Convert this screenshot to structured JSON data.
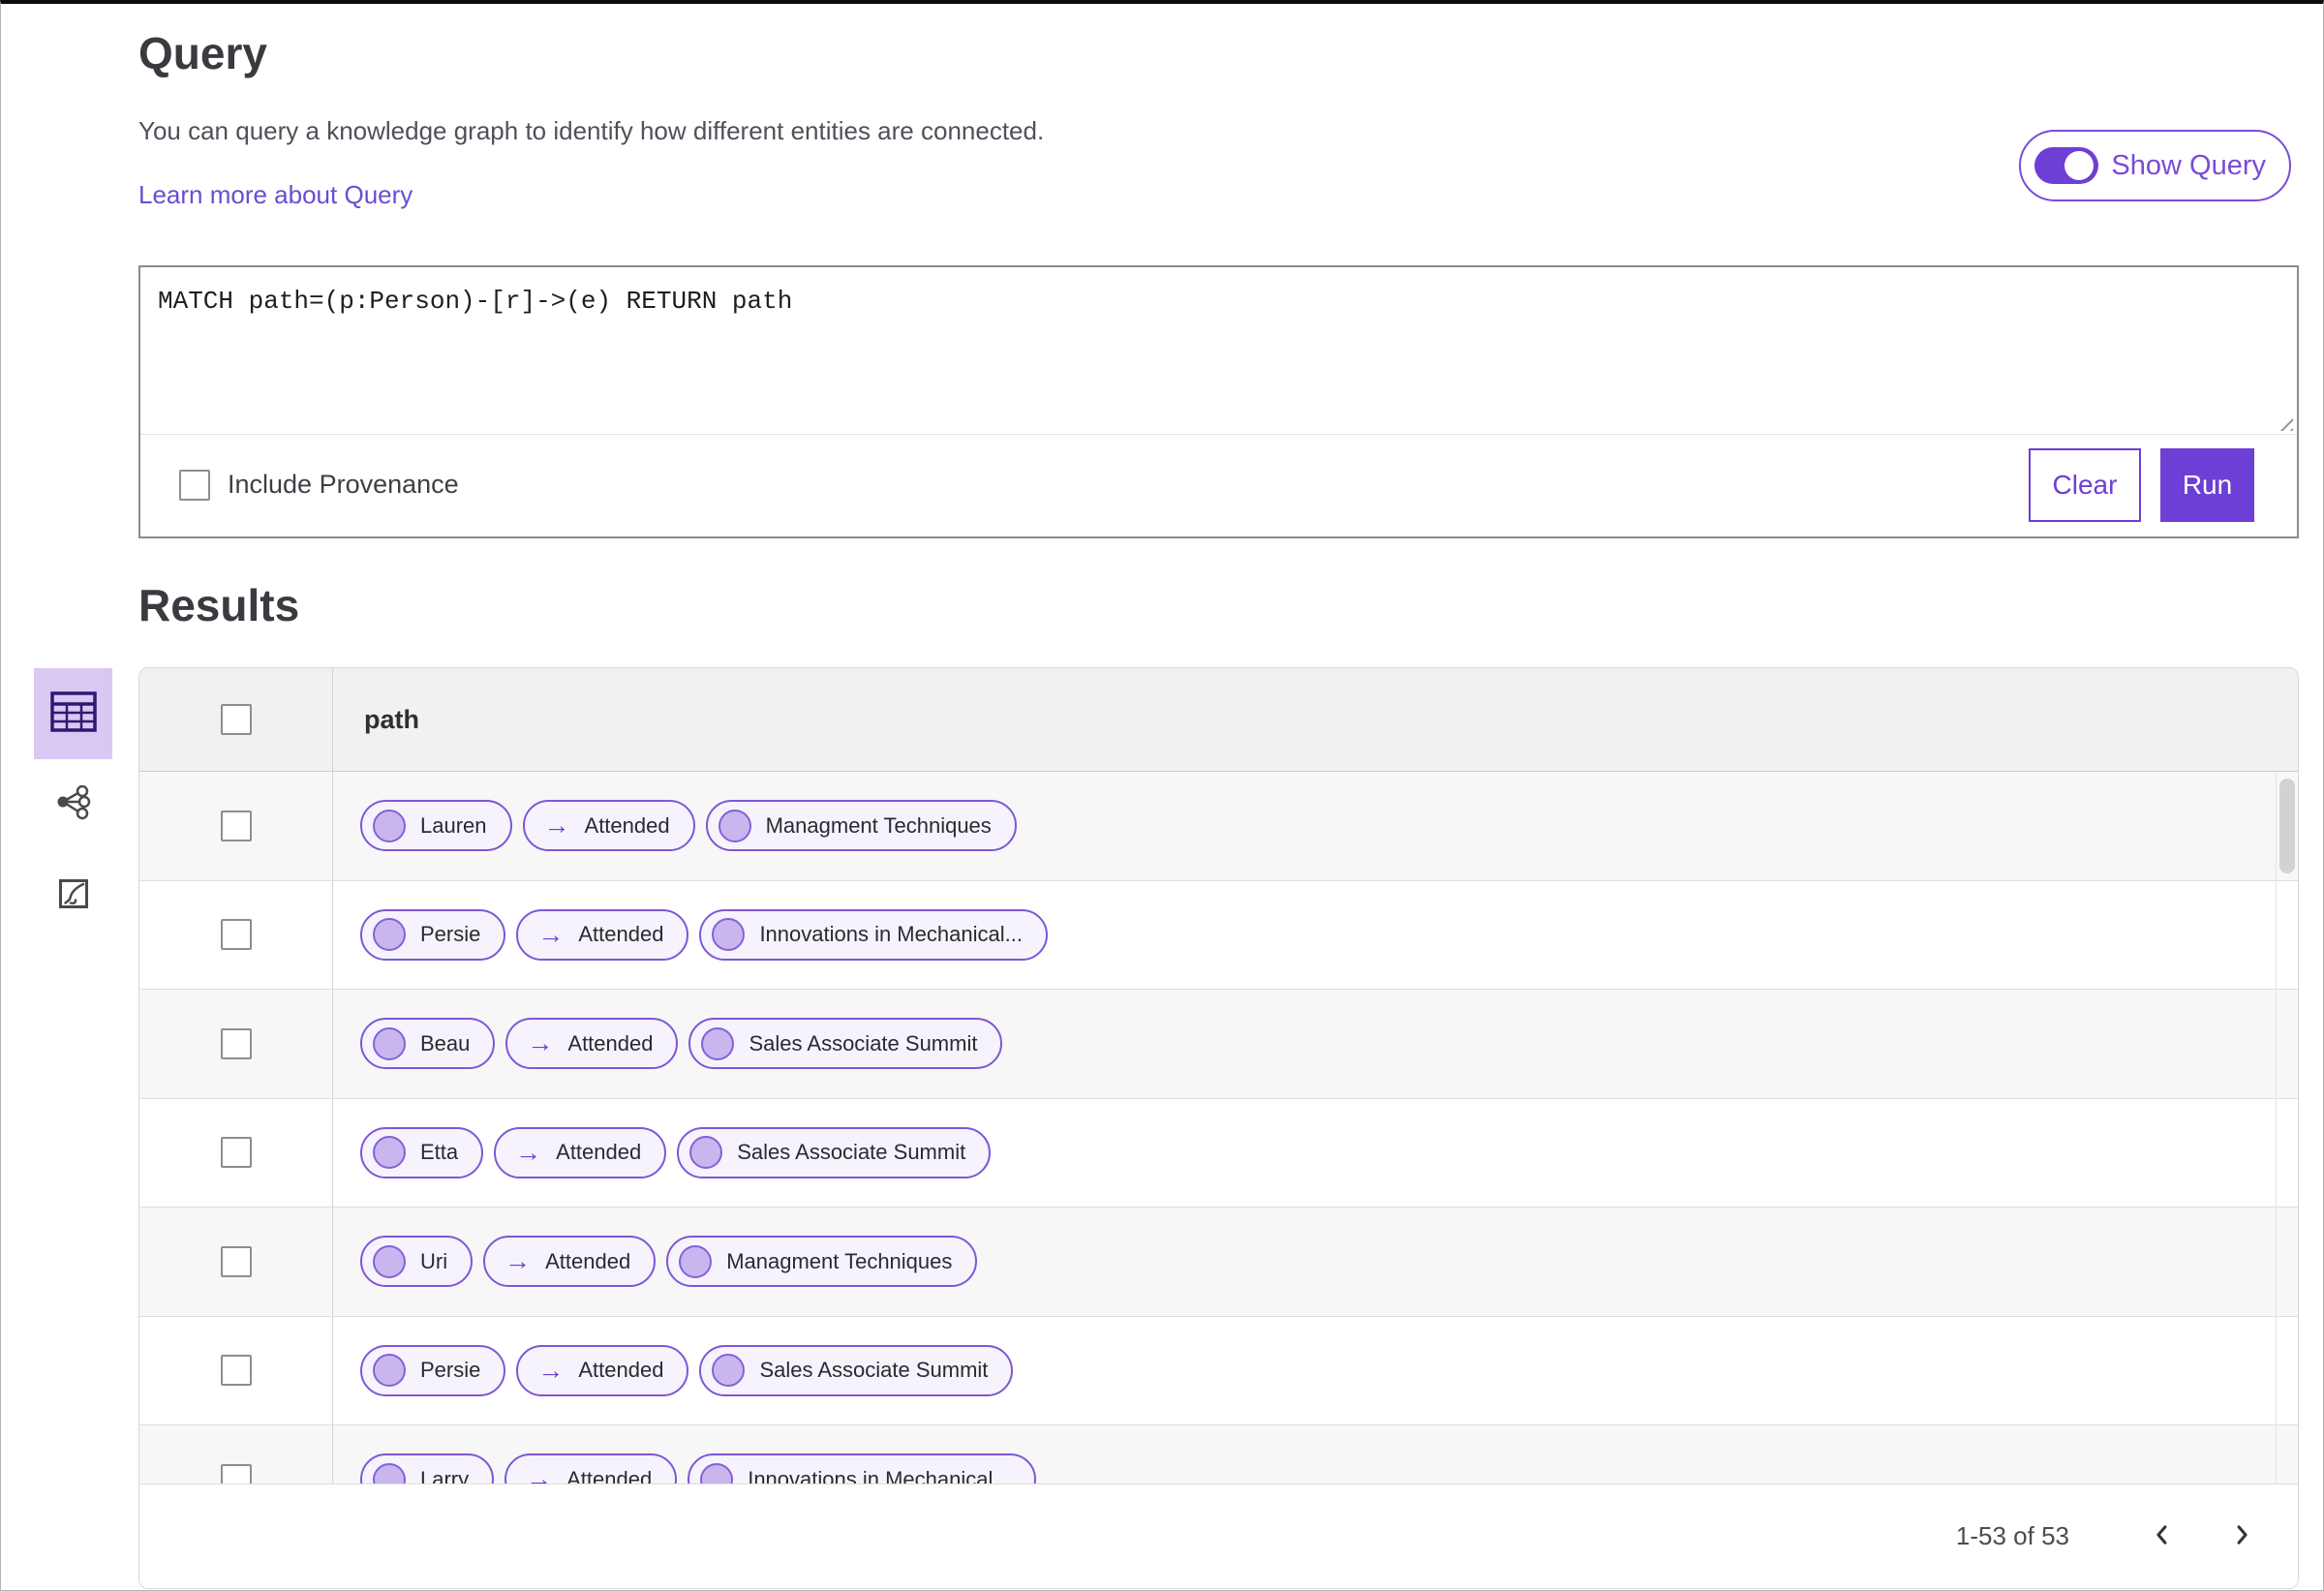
{
  "page": {
    "title": "Query",
    "description": "You can query a knowledge graph to identify how different entities are connected.",
    "learn_more": "Learn more about Query",
    "show_query_label": "Show Query",
    "show_query_on": true
  },
  "query_editor": {
    "query_text": "MATCH path=(p:Person)-[r]->(e) RETURN path",
    "include_provenance_label": "Include Provenance",
    "include_provenance_checked": false,
    "clear_label": "Clear",
    "run_label": "Run"
  },
  "results": {
    "heading": "Results",
    "column_header": "path",
    "view_modes": [
      {
        "id": "table",
        "icon": "table-view-icon",
        "selected": true
      },
      {
        "id": "graph",
        "icon": "graph-view-icon",
        "selected": false
      },
      {
        "id": "chart",
        "icon": "chart-view-icon",
        "selected": false
      }
    ],
    "rows": [
      {
        "source": "Lauren",
        "edge": "Attended",
        "target": "Managment Techniques"
      },
      {
        "source": "Persie",
        "edge": "Attended",
        "target": "Innovations in Mechanical..."
      },
      {
        "source": "Beau",
        "edge": "Attended",
        "target": "Sales Associate Summit"
      },
      {
        "source": "Etta",
        "edge": "Attended",
        "target": "Sales Associate Summit"
      },
      {
        "source": "Uri",
        "edge": "Attended",
        "target": "Managment Techniques"
      },
      {
        "source": "Persie",
        "edge": "Attended",
        "target": "Sales Associate Summit"
      },
      {
        "source": "Larry",
        "edge": "Attended",
        "target": "Innovations in Mechanical..."
      }
    ],
    "pagination": {
      "range_text": "1-53 of 53"
    }
  },
  "icons": {
    "edge_arrow": "→"
  },
  "colors": {
    "accent": "#6d3fd4",
    "pill_border": "#7e57d6",
    "pill_bg": "#f6f3fc",
    "node_dot": "#c9b6ee",
    "selected_view_bg": "#d9c8f4",
    "link": "#6a4dd1",
    "header_row_bg": "#f1f1f1",
    "stripe_row_bg": "#f7f7f7"
  }
}
